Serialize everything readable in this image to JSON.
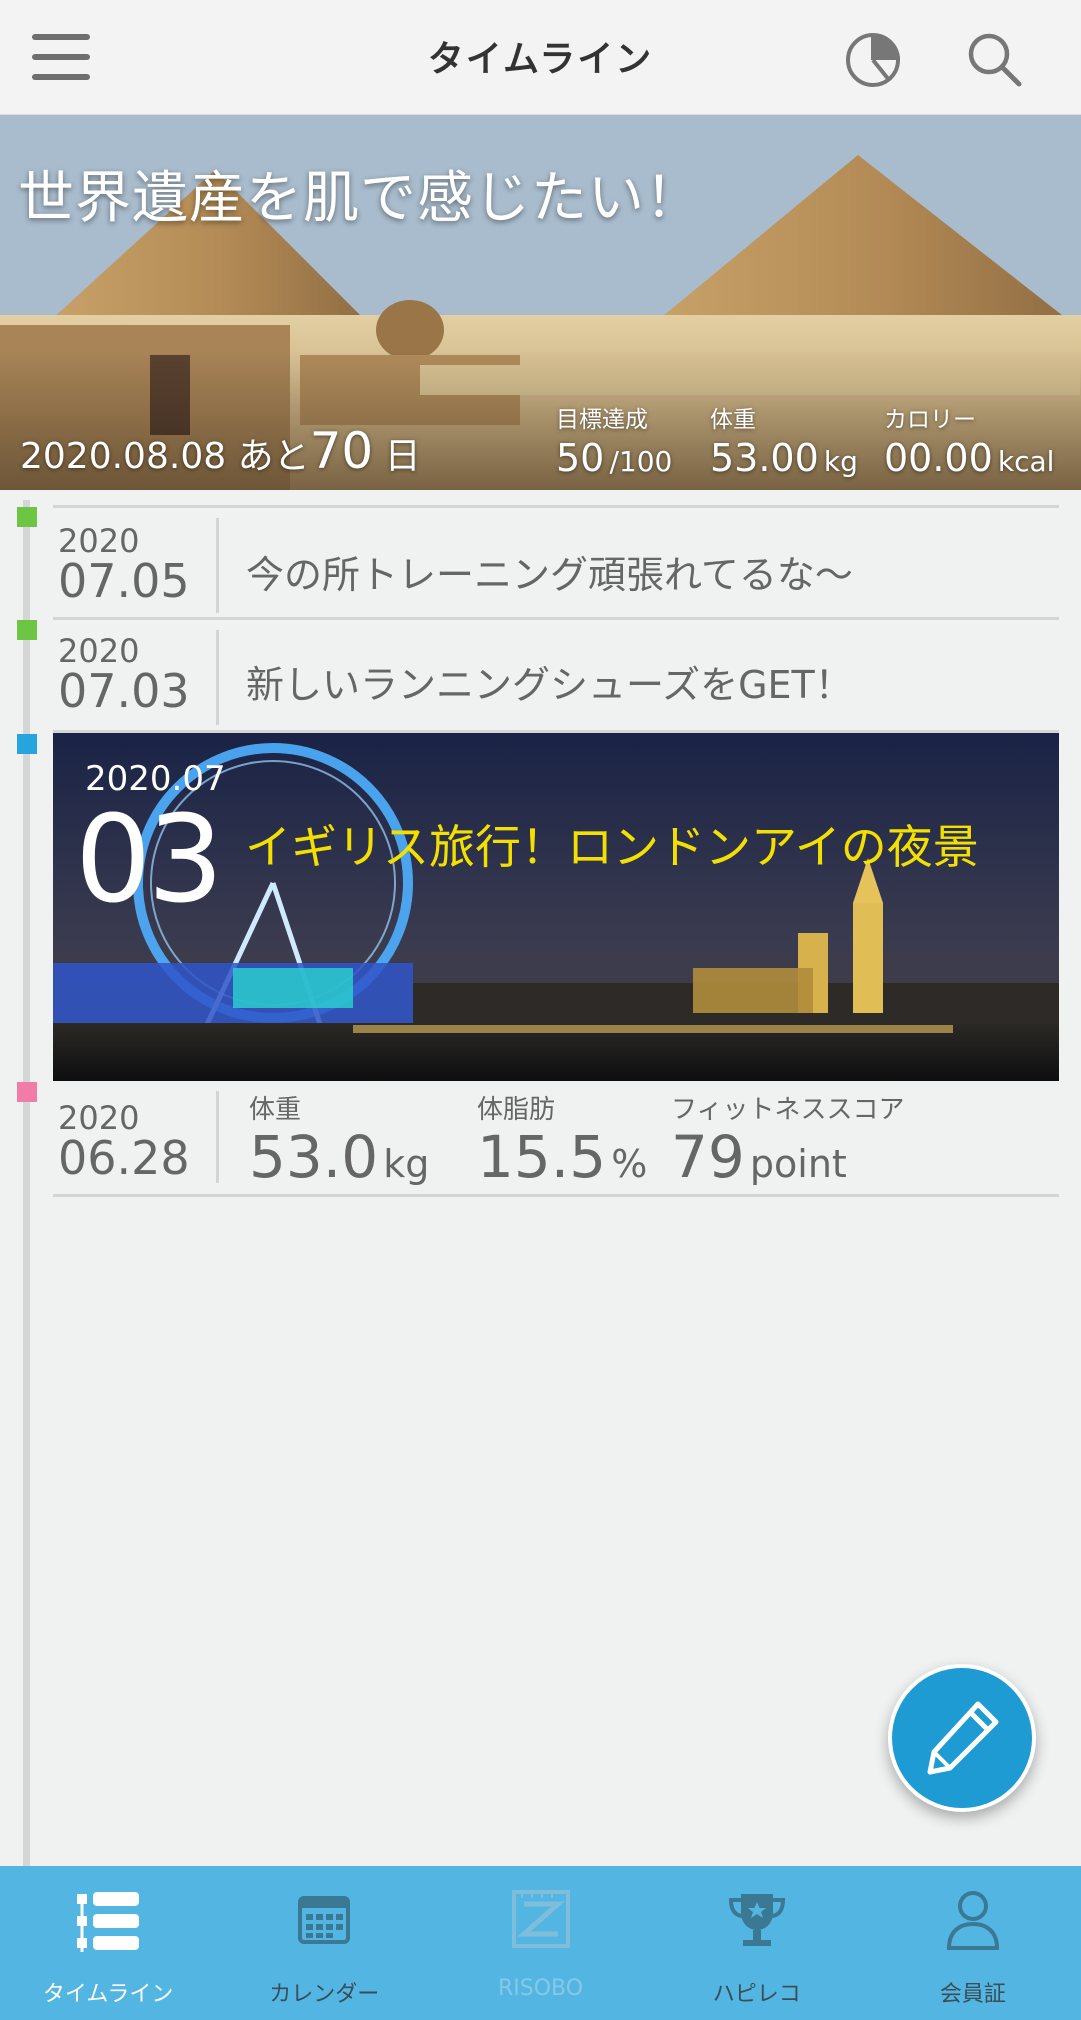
{
  "header": {
    "title": "タイムライン",
    "menu_icon": "hamburger-menu-icon",
    "chart_icon": "pie-chart-icon",
    "search_icon": "search-icon"
  },
  "hero": {
    "title": "世界遺産を肌で感じたい！",
    "date": "2020.08.08",
    "remaining_prefix": "あと",
    "remaining_days": "70",
    "remaining_suffix": "日",
    "goal_label": "目標達成",
    "goal_value": "50",
    "goal_total": "/100",
    "weight_label": "体重",
    "weight_value": "53.00",
    "weight_unit": "kg",
    "calorie_label": "カロリー",
    "calorie_value": "00.00",
    "calorie_unit": "kcal"
  },
  "timeline": {
    "entries": [
      {
        "year": "2020",
        "date": "07.05",
        "text": "今の所トレーニング頑張れてるな〜",
        "dot_color": "#6cc644"
      },
      {
        "year": "2020",
        "date": "07.03",
        "text": "新しいランニングシューズをGET！",
        "dot_color": "#6cc644"
      }
    ],
    "photo": {
      "year_month": "2020.07",
      "day": "03",
      "caption": "イギリス旅行！ロンドンアイの夜景",
      "dot_color": "#27a3dd"
    },
    "stats": {
      "year": "2020",
      "date": "06.28",
      "dot_color": "#f07ca7",
      "weight_label": "体重",
      "weight_value": "53.0",
      "weight_unit": "kg",
      "fat_label": "体脂肪",
      "fat_value": "15.5",
      "fat_unit": "%",
      "fitness_label": "フィットネススコア",
      "fitness_value": "79",
      "fitness_unit": "point"
    }
  },
  "fab": {
    "icon": "pencil-icon"
  },
  "tabbar": {
    "tabs": [
      {
        "label": "タイムライン",
        "icon": "timeline-list-icon",
        "state": "active"
      },
      {
        "label": "カレンダー",
        "icon": "calendar-icon",
        "state": "normal"
      },
      {
        "label": "RISOBO",
        "icon": "risobo-icon",
        "state": "disabled"
      },
      {
        "label": "ハピレコ",
        "icon": "trophy-icon",
        "state": "normal"
      },
      {
        "label": "会員証",
        "icon": "member-card-icon",
        "state": "normal"
      }
    ]
  }
}
